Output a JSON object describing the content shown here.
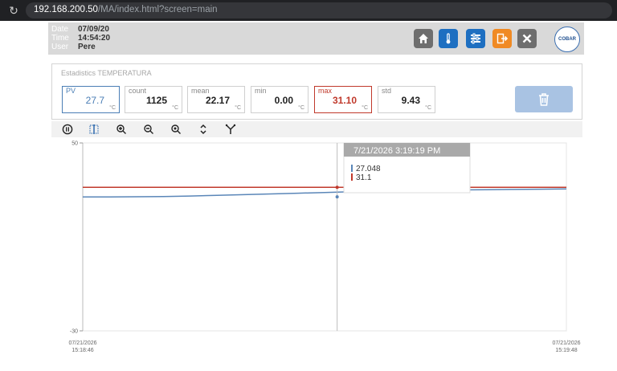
{
  "browser": {
    "url_host": "192.168.200.50",
    "url_path": "/MA/index.html?screen=main"
  },
  "header": {
    "date_label": "Date",
    "date_value": "07/09/20",
    "time_label": "Time",
    "time_value": "14:54:20",
    "user_label": "User",
    "user_value": "Pere",
    "logo_text": "COBAR",
    "buttons": [
      {
        "name": "home",
        "icon": "home-icon",
        "color": "#6e6e6e"
      },
      {
        "name": "thermometer",
        "icon": "thermometer-icon",
        "color": "#1e6fc1"
      },
      {
        "name": "settings",
        "icon": "sliders-icon",
        "color": "#1e6fc1"
      },
      {
        "name": "logout",
        "icon": "logout-icon",
        "color": "#f08a24"
      },
      {
        "name": "close",
        "icon": "close-icon",
        "color": "#6e6e6e"
      }
    ]
  },
  "stats": {
    "title": "Estadistics TEMPERATURA",
    "unit": "°C",
    "items": [
      {
        "label": "PV",
        "value": "27.7",
        "accent": "#4a7eb5"
      },
      {
        "label": "count",
        "value": "1125",
        "accent": ""
      },
      {
        "label": "mean",
        "value": "22.17",
        "accent": ""
      },
      {
        "label": "min",
        "value": "0.00",
        "accent": ""
      },
      {
        "label": "max",
        "value": "31.10",
        "accent": "#c0392b"
      },
      {
        "label": "std",
        "value": "9.43",
        "accent": ""
      }
    ]
  },
  "toolbar": {
    "tools": [
      "pause-icon",
      "select-range-icon",
      "zoom-in-icon",
      "zoom-out-icon",
      "zoom-reset-icon",
      "expand-vertical-icon",
      "merge-icon"
    ]
  },
  "chart_data": {
    "type": "line",
    "ylim": [
      -30,
      50
    ],
    "y_tick_labels": [
      "50",
      "-30"
    ],
    "x_start_label": [
      "07/21/2026",
      "15:18:46"
    ],
    "x_end_label": [
      "07/21/2026",
      "15:19:48"
    ],
    "series": [
      {
        "color": "#5a86b8",
        "values": [
          27.0,
          27.0,
          27.1,
          27.2,
          27.4,
          27.7,
          28.0,
          28.3,
          28.6,
          28.9,
          29.2,
          29.5,
          29.7,
          29.9,
          30.0,
          30.1,
          30.2,
          30.3,
          30.4
        ]
      },
      {
        "color": "#c0392b",
        "values": [
          31.1,
          31.1,
          31.1,
          31.1,
          31.1,
          31.1,
          31.1,
          31.1,
          31.1,
          31.1,
          31.1,
          31.1,
          31.1,
          31.1,
          31.1,
          31.1,
          31.1,
          31.1,
          31.1
        ]
      }
    ],
    "tooltip": {
      "title": "7/21/2026 3:19:19 PM",
      "values": [
        "27.048",
        "31.1"
      ],
      "cursor_fraction": 0.526
    }
  }
}
